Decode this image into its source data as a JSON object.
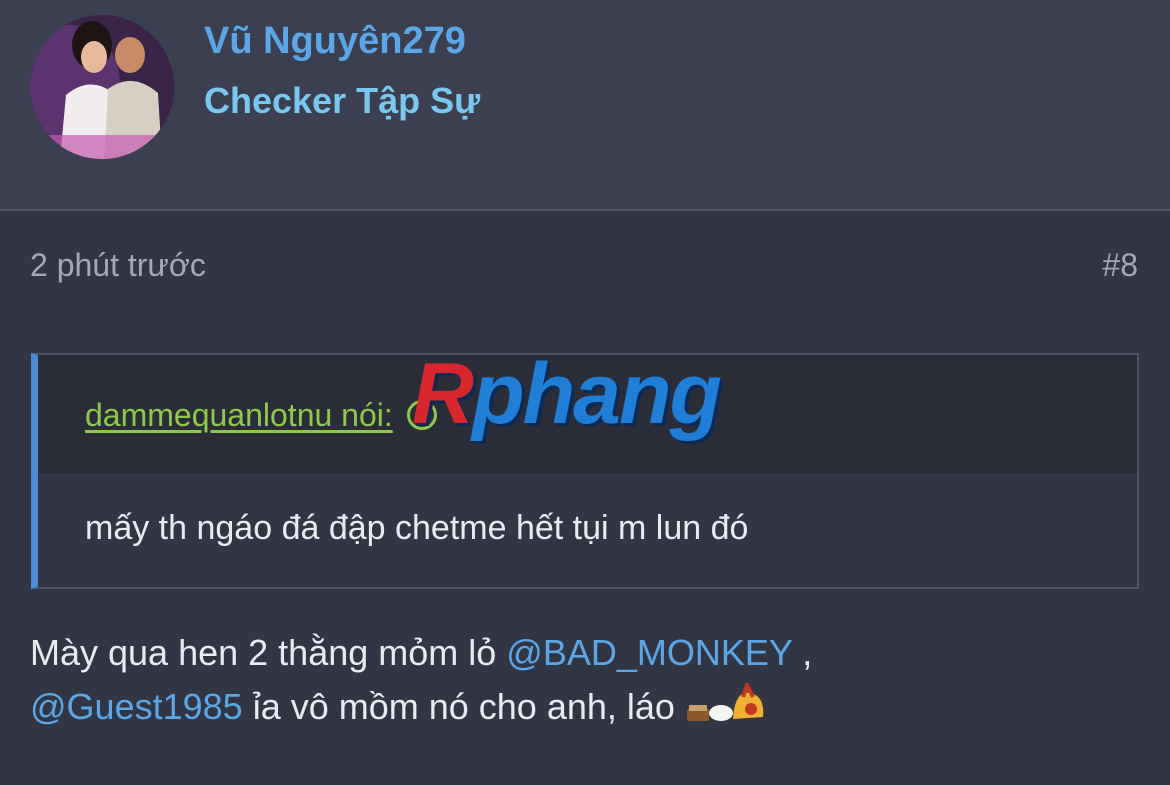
{
  "user": {
    "name": "Vũ Nguyên279",
    "title": "Checker Tập Sự"
  },
  "post": {
    "time": "2 phút trước",
    "number": "#8"
  },
  "quote": {
    "author_label": "dammequanlotnu nói:",
    "text": "mấy th ngáo đá đập chetme hết tụi m lun đó"
  },
  "watermark": {
    "first_letter": "R",
    "rest": "phang"
  },
  "message": {
    "part1": "Mày qua hen 2 thằng mỏm lỏ ",
    "mention1": "@BAD_MONKEY",
    "part2": " ,",
    "mention2": "@Guest1985",
    "part3": " ỉa vô mồm nó cho anh, láo "
  },
  "colors": {
    "accent": "#5aa6e6",
    "quote_author": "#8fc94a",
    "quote_border": "#4a8ad6"
  }
}
